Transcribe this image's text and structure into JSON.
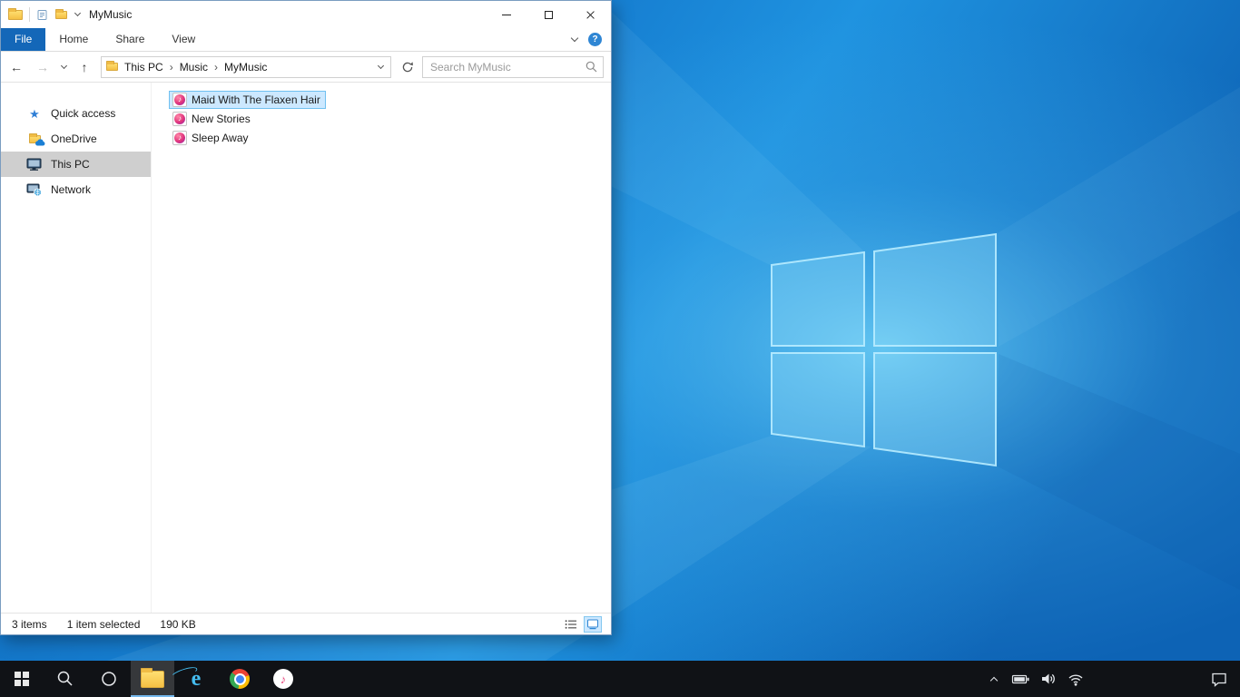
{
  "titlebar": {
    "title": "MyMusic"
  },
  "ribbon": {
    "tabs": [
      {
        "label": "File",
        "active": true
      },
      {
        "label": "Home",
        "active": false
      },
      {
        "label": "Share",
        "active": false
      },
      {
        "label": "View",
        "active": false
      }
    ]
  },
  "address": {
    "crumbs": [
      "This PC",
      "Music",
      "MyMusic"
    ],
    "search_placeholder": "Search MyMusic"
  },
  "sidebar": {
    "items": [
      {
        "label": "Quick access",
        "icon": "star-icon",
        "selected": false
      },
      {
        "label": "OneDrive",
        "icon": "onedrive-folder-icon",
        "selected": false
      },
      {
        "label": "This PC",
        "icon": "computer-icon",
        "selected": true
      },
      {
        "label": "Network",
        "icon": "network-icon",
        "selected": false
      }
    ]
  },
  "files": [
    {
      "name": "Maid With The Flaxen Hair",
      "icon": "music-file-icon",
      "selected": true
    },
    {
      "name": "New Stories",
      "icon": "music-file-icon",
      "selected": false
    },
    {
      "name": "Sleep Away",
      "icon": "music-file-icon",
      "selected": false
    }
  ],
  "status": {
    "items": "3 items",
    "selection": "1 item selected",
    "size": "190 KB"
  },
  "icons": {
    "back": "←",
    "forward": "→",
    "up": "↑",
    "help": "?",
    "crumb_sep": "›",
    "star": "★",
    "music_note": "♪",
    "ie_glyph": "e"
  },
  "colors": {
    "accent": "#0078d7",
    "file_tab_blue": "#1467b8",
    "selection_bg": "#cce8ff",
    "selection_border": "#70c0f0",
    "sidebar_selected": "#cfcfcf",
    "taskbar_bg": "#101216"
  }
}
